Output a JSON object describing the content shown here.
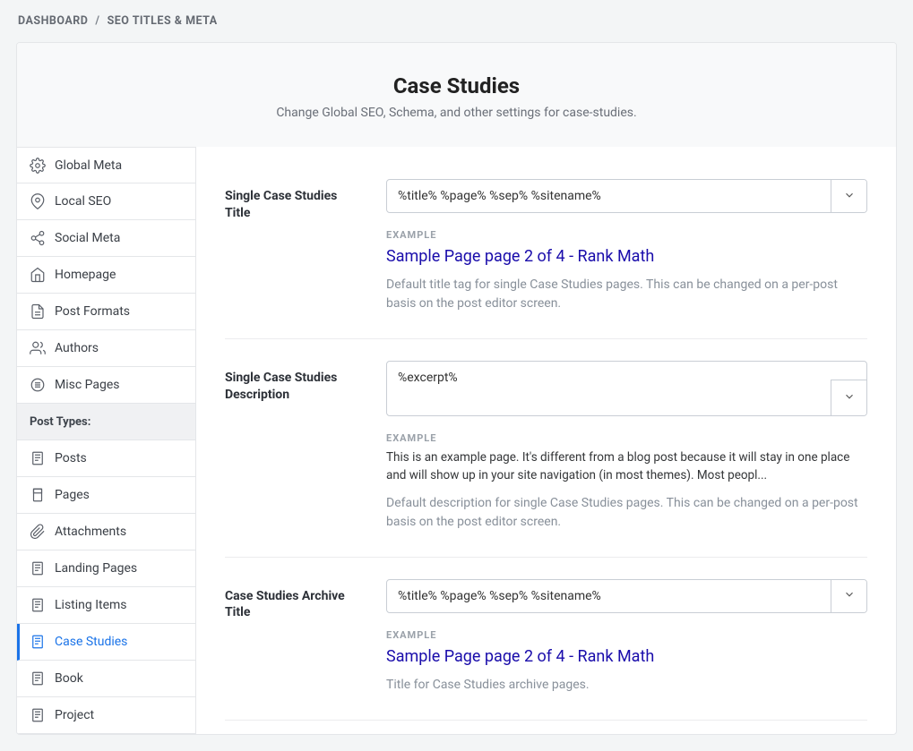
{
  "breadcrumbs": {
    "items": [
      "DASHBOARD",
      "SEO TITLES & META"
    ],
    "sep": "/"
  },
  "header": {
    "title": "Case Studies",
    "subtitle": "Change Global SEO, Schema, and other settings for case-studies."
  },
  "sidebar": {
    "section_label": "Post Types:",
    "items": [
      {
        "label": "Global Meta",
        "icon": "gear"
      },
      {
        "label": "Local SEO",
        "icon": "pin"
      },
      {
        "label": "Social Meta",
        "icon": "share"
      },
      {
        "label": "Homepage",
        "icon": "home"
      },
      {
        "label": "Post Formats",
        "icon": "doc"
      },
      {
        "label": "Authors",
        "icon": "users"
      },
      {
        "label": "Misc Pages",
        "icon": "circles"
      }
    ],
    "post_types": [
      {
        "label": "Posts",
        "icon": "post"
      },
      {
        "label": "Pages",
        "icon": "page"
      },
      {
        "label": "Attachments",
        "icon": "clip"
      },
      {
        "label": "Landing Pages",
        "icon": "post"
      },
      {
        "label": "Listing Items",
        "icon": "post"
      },
      {
        "label": "Case Studies",
        "icon": "post",
        "active": true
      },
      {
        "label": "Book",
        "icon": "post"
      },
      {
        "label": "Project",
        "icon": "post"
      }
    ]
  },
  "fields": {
    "single_title": {
      "label": "Single Case Studies Title",
      "value": "%title% %page% %sep% %sitename%",
      "example_label": "EXAMPLE",
      "example_link": "Sample Page page 2 of 4 - Rank Math",
      "help": "Default title tag for single Case Studies pages. This can be changed on a per-post basis on the post editor screen."
    },
    "single_desc": {
      "label": "Single Case Studies Description",
      "value": "%excerpt%",
      "example_label": "EXAMPLE",
      "example_text": "This is an example page. It's different from a blog post because it will stay in one place and will show up in your site navigation (in most themes). Most peopl...",
      "help": "Default description for single Case Studies pages. This can be changed on a per-post basis on the post editor screen."
    },
    "archive_title": {
      "label": "Case Studies Archive Title",
      "value": "%title% %page% %sep% %sitename%",
      "example_label": "EXAMPLE",
      "example_link": "Sample Page page 2 of 4 - Rank Math",
      "help": "Title for Case Studies archive pages."
    }
  }
}
